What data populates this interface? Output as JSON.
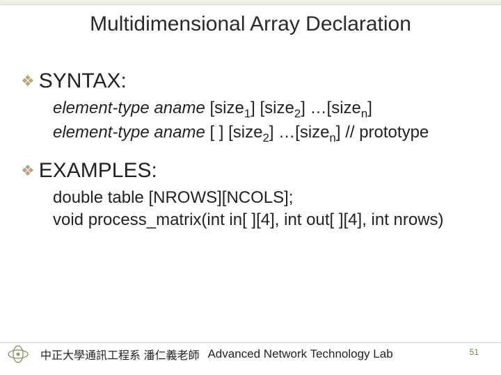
{
  "title": "Multidimensional Array Declaration",
  "sections": [
    {
      "heading": "SYNTAX:",
      "lines": [
        {
          "italic_prefix": "element-type aname",
          "rest": " [size",
          "sub1": "1",
          "mid1": "] [size",
          "sub2": "2",
          "mid2": "] …[size",
          "sub3": "n",
          "end": "]"
        },
        {
          "italic_prefix": "element-type aname",
          "rest": " [ ] [size",
          "sub1": "2",
          "mid1": "] …[size",
          "sub2": "n",
          "mid2": "] // prototype",
          "sub3": "",
          "end": ""
        }
      ]
    },
    {
      "heading": "EXAMPLES:",
      "lines_plain": [
        "double table [NROWS][NCOLS];",
        "void process_matrix(int in[ ][4], int out[ ][4], int nrows)"
      ]
    }
  ],
  "footer": {
    "chinese": "中正大學通訊工程系 潘仁義老師",
    "lab": "Advanced Network Technology Lab"
  },
  "page_number": "51"
}
